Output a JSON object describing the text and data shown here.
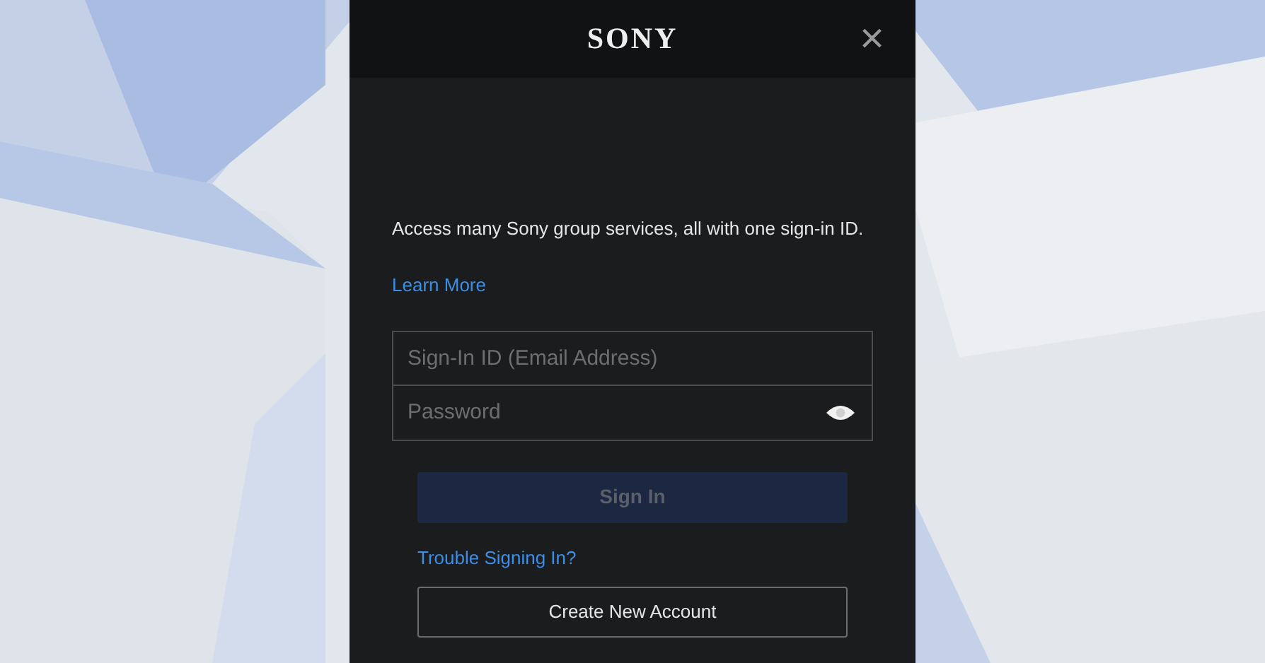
{
  "header": {
    "logo": "SONY",
    "close": "×"
  },
  "intro": "Access many Sony group services, all with one sign-in ID.",
  "learn_more": "Learn More",
  "fields": [
    {
      "kind": "text",
      "placeholder": "Sign-In ID (Email Address)"
    },
    {
      "kind": "password",
      "placeholder": "Password"
    }
  ],
  "sign_in": {
    "label": "Sign In",
    "disabled": true
  },
  "trouble": "Trouble Signing In?",
  "create": "Create New Account"
}
